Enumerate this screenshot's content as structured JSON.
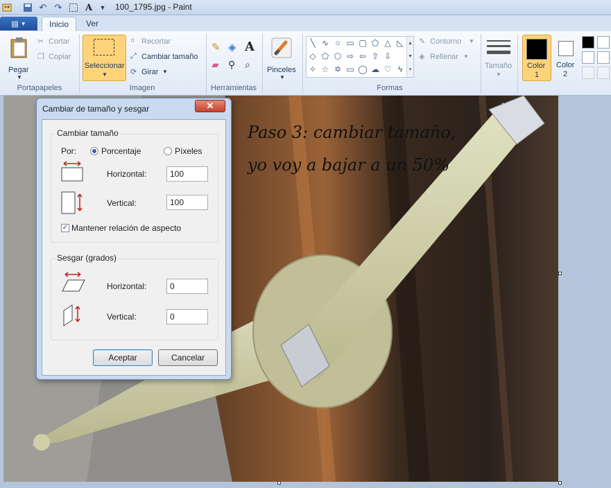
{
  "window": {
    "title": "100_1795.jpg - Paint"
  },
  "tabs": {
    "inicio": "Inicio",
    "ver": "Ver"
  },
  "ribbon": {
    "clipboard": {
      "paste": "Pegar",
      "cut": "Cortar",
      "copy": "Copiar",
      "label": "Portapapeles"
    },
    "image": {
      "select": "Seleccionar",
      "crop": "Recortar",
      "resize": "Cambiar tamaño",
      "rotate": "Girar",
      "label": "Imagen"
    },
    "tools": {
      "label": "Herramientas"
    },
    "brushes": {
      "label": "Pinceles"
    },
    "shapes": {
      "outline": "Contorno",
      "fill": "Rellenar",
      "label": "Formas"
    },
    "size": {
      "label": "Tamaño"
    },
    "color1": {
      "line1": "Color",
      "line2": "1"
    },
    "color2": {
      "line1": "Color",
      "line2": "2"
    }
  },
  "canvas": {
    "annotation_line1": "Paso 3: cambiar tamaño,",
    "annotation_line2": "yo voy a bajar a un 50%"
  },
  "dialog": {
    "title": "Cambiar de tamaño y sesgar",
    "close_glyph": "✕",
    "resize": {
      "legend": "Cambiar tamaño",
      "by_label": "Por:",
      "option_percent": "Porcentaje",
      "option_pixels": "Píxeles",
      "horizontal_label": "Horizontal:",
      "horizontal_value": "100",
      "vertical_label": "Vertical:",
      "vertical_value": "100",
      "keep_aspect_label": "Mantener relación de aspecto"
    },
    "skew": {
      "legend": "Sesgar (grados)",
      "horizontal_label": "Horizontal:",
      "horizontal_value": "0",
      "vertical_label": "Vertical:",
      "vertical_value": "0"
    },
    "ok_label": "Aceptar",
    "cancel_label": "Cancelar"
  },
  "colors": {
    "selected_button": "#ffd37a",
    "dialog_frame": "#c9daf0",
    "close_button": "#c8432c",
    "arrow_red": "#c0261e"
  }
}
